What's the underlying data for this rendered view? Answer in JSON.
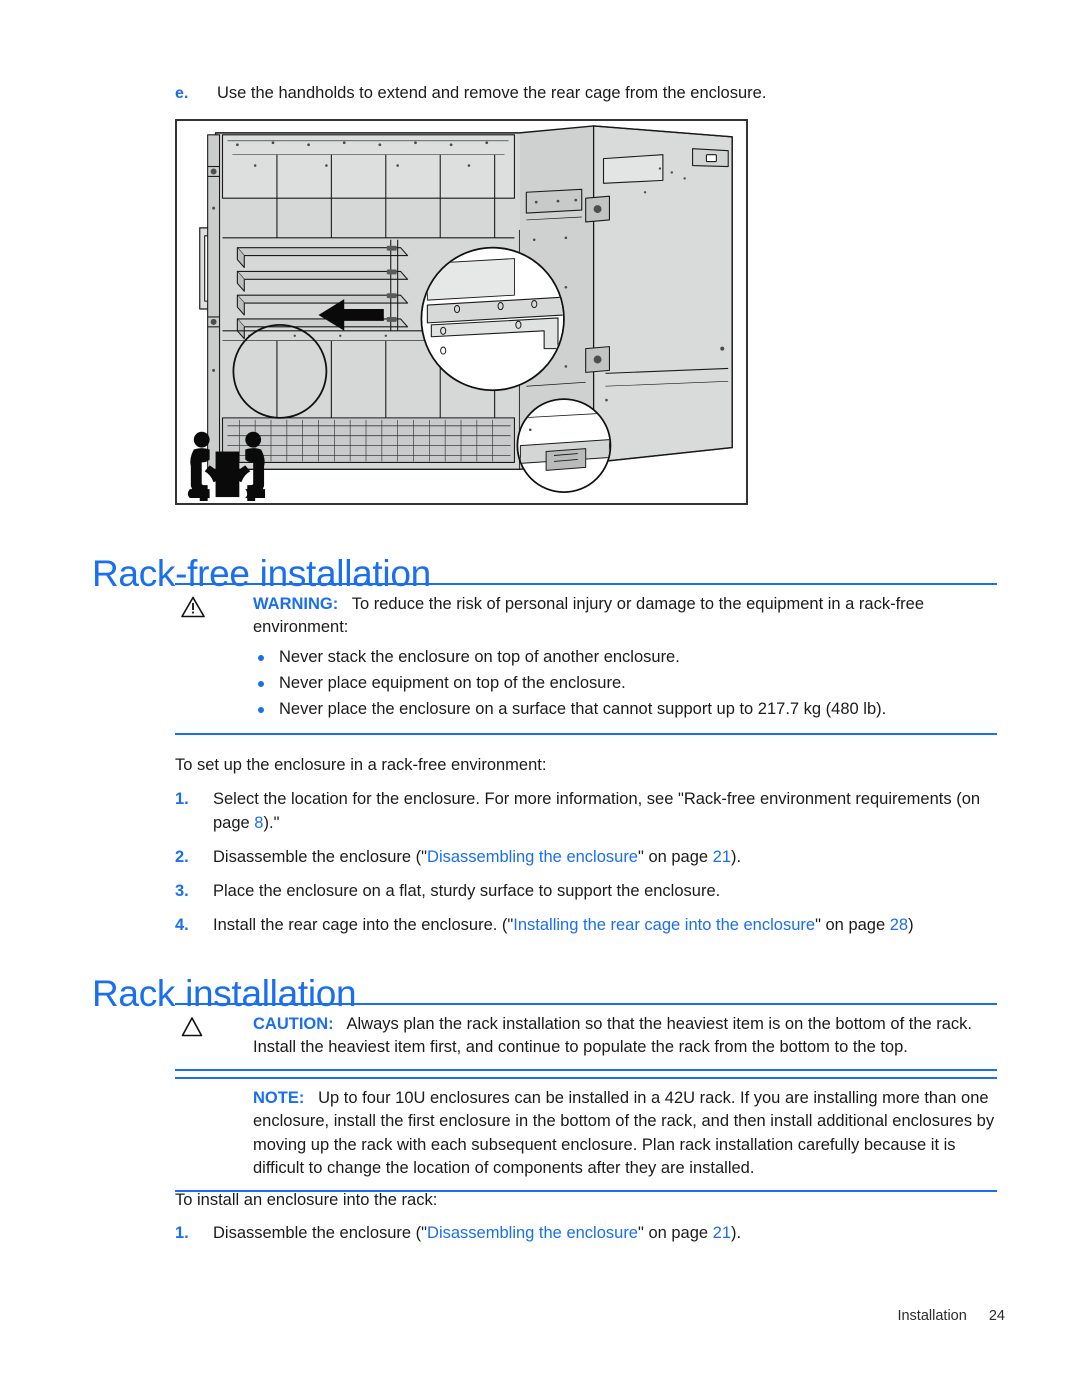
{
  "document": {
    "footer_section": "Installation",
    "footer_page": "24"
  },
  "colors": {
    "accent_blue": "#1a6ef0",
    "body_text": "#1b1b1b",
    "figure_border": "#333333"
  },
  "lettered_step": {
    "marker": "e.",
    "text": "Use the handholds to extend and remove the rear cage from the enclosure."
  },
  "figure": {
    "caption": "",
    "alt": "Line drawing of a server enclosure with the rear cage partially extended, showing an arrow indicating the removal direction, three magnified callout circles, and a two-person lift icon."
  },
  "sections": [
    {
      "id": "rack-free-installation",
      "heading": "Rack-free installation"
    },
    {
      "id": "rack-installation",
      "heading": "Rack installation"
    }
  ],
  "warning": {
    "icon": "warning-triangle-icon",
    "label": "WARNING:",
    "intro": "To reduce the risk of personal injury or damage to the equipment in a rack-free environment:",
    "items": [
      "Never stack the enclosure on top of another enclosure.",
      "Never place equipment on top of the enclosure.",
      "Never place the enclosure on a surface that cannot support up to 217.7 kg (480 lb)."
    ]
  },
  "caution": {
    "icon": "caution-triangle-icon",
    "label": "CAUTION:",
    "text": "Always plan the rack installation so that the heaviest item is on the bottom of the rack. Install the heaviest item first, and continue to populate the rack from the bottom to the top."
  },
  "note": {
    "label": "NOTE:",
    "text": "Up to four 10U enclosures can be installed in a 42U rack. If you are installing more than one enclosure, install the first enclosure in the bottom of the rack, and then install additional enclosures by moving up the rack with each subsequent enclosure. Plan rack installation carefully because it is difficult to change the location of components after they are installed."
  },
  "rack_free_procedure": {
    "lead": "To set up the enclosure in a rack-free environment:",
    "steps": [
      {
        "number": "1.",
        "parts": [
          {
            "t": "Select the location for the enclosure. For more information, see \"Rack-free environment requirements (on page ",
            "link": false
          },
          {
            "t": "8",
            "link": true
          },
          {
            "t": ").\"",
            "link": false
          }
        ]
      },
      {
        "number": "2.",
        "parts": [
          {
            "t": "Disassemble the enclosure (\"",
            "link": false
          },
          {
            "t": "Disassembling the enclosure",
            "link": true
          },
          {
            "t": "\" on page ",
            "link": false
          },
          {
            "t": "21",
            "link": true
          },
          {
            "t": ").",
            "link": false
          }
        ]
      },
      {
        "number": "3.",
        "parts": [
          {
            "t": "Place the enclosure on a flat, sturdy surface to support the enclosure.",
            "link": false
          }
        ]
      },
      {
        "number": "4.",
        "parts": [
          {
            "t": "Install the rear cage into the enclosure. (\"",
            "link": false
          },
          {
            "t": "Installing the rear cage into the enclosure",
            "link": true
          },
          {
            "t": "\" on page ",
            "link": false
          },
          {
            "t": "28",
            "link": true
          },
          {
            "t": ")",
            "link": false
          }
        ]
      }
    ]
  },
  "rack_procedure": {
    "lead": "To install an enclosure into the rack:",
    "steps": [
      {
        "number": "1.",
        "parts": [
          {
            "t": "Disassemble the enclosure (\"",
            "link": false
          },
          {
            "t": "Disassembling the enclosure",
            "link": true
          },
          {
            "t": "\" on page ",
            "link": false
          },
          {
            "t": "21",
            "link": true
          },
          {
            "t": ").",
            "link": false
          }
        ]
      }
    ]
  }
}
